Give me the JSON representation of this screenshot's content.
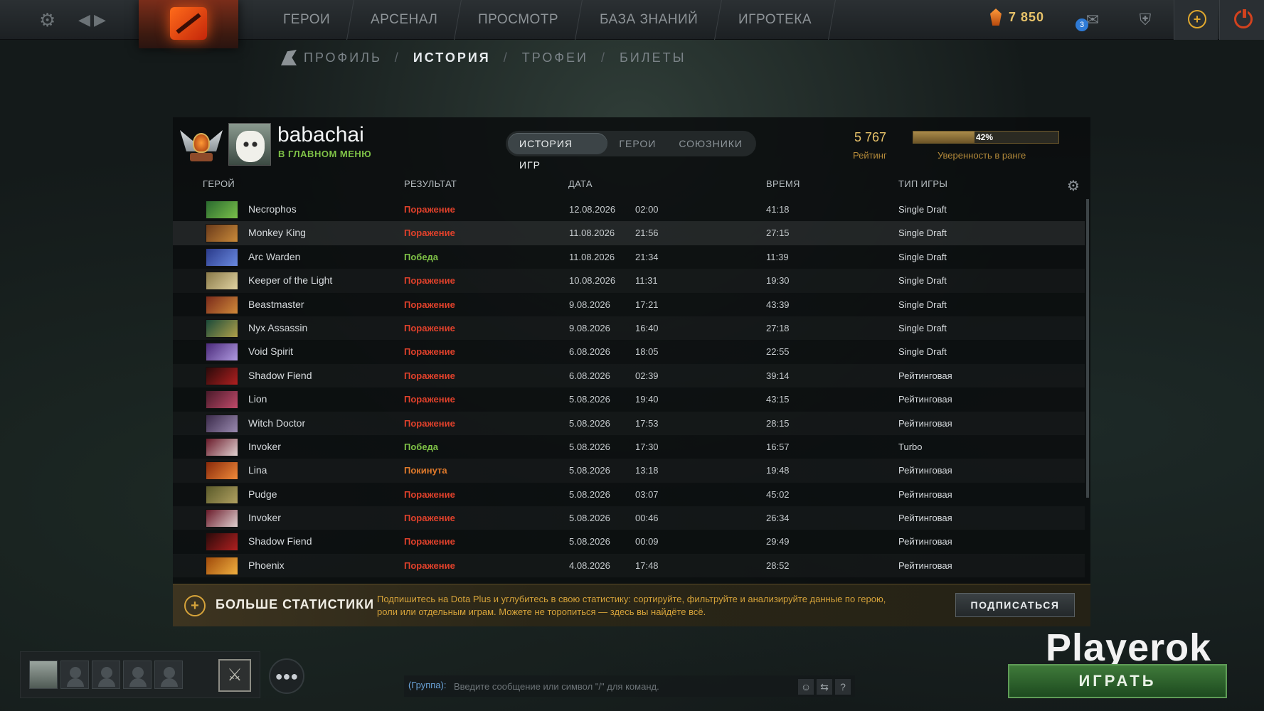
{
  "topbar": {
    "nav": [
      "ГЕРОИ",
      "АРСЕНАЛ",
      "ПРОСМОТР",
      "БАЗА ЗНАНИЙ",
      "ИГРОТЕКА"
    ],
    "currency": "7 850",
    "notifications": "3"
  },
  "subnav": {
    "items": [
      "ПРОФИЛЬ",
      "ИСТОРИЯ",
      "ТРОФЕИ",
      "БИЛЕТЫ"
    ],
    "active": "ИСТОРИЯ",
    "separator": "/"
  },
  "profile": {
    "username": "babachai",
    "status": "В ГЛАВНОМ МЕНЮ",
    "rating_value": "5 767",
    "rating_label": "Рейтинг",
    "confidence_value": 42,
    "confidence_text": "42%",
    "confidence_label": "Уверенность в ранге"
  },
  "tabs": [
    "ИСТОРИЯ ИГР",
    "ГЕРОИ",
    "СОЮЗНИКИ"
  ],
  "columns": {
    "hero": "ГЕРОЙ",
    "result": "РЕЗУЛЬТАТ",
    "date": "ДАТА",
    "time": "ВРЕМЯ",
    "mode": "ТИП ИГРЫ"
  },
  "matches": [
    {
      "hero": "Necrophos",
      "result": "Поражение",
      "outcome": "loss",
      "date": "12.08.2026",
      "time": "02:00",
      "duration": "41:18",
      "mode": "Single Draft",
      "colors": [
        "#2a6a2f",
        "#7ac04a"
      ]
    },
    {
      "hero": "Monkey King",
      "result": "Поражение",
      "outcome": "loss",
      "date": "11.08.2026",
      "time": "21:56",
      "duration": "27:15",
      "mode": "Single Draft",
      "colors": [
        "#6a3a1a",
        "#c98a3a"
      ]
    },
    {
      "hero": "Arc Warden",
      "result": "Победа",
      "outcome": "win",
      "date": "11.08.2026",
      "time": "21:34",
      "duration": "11:39",
      "mode": "Single Draft",
      "colors": [
        "#2a3a8a",
        "#6a8ae0"
      ]
    },
    {
      "hero": "Keeper of the Light",
      "result": "Поражение",
      "outcome": "loss",
      "date": "10.08.2026",
      "time": "11:31",
      "duration": "19:30",
      "mode": "Single Draft",
      "colors": [
        "#8a7a4a",
        "#e0d2a0"
      ]
    },
    {
      "hero": "Beastmaster",
      "result": "Поражение",
      "outcome": "loss",
      "date": "9.08.2026",
      "time": "17:21",
      "duration": "43:39",
      "mode": "Single Draft",
      "colors": [
        "#7a2a1a",
        "#d08a3a"
      ]
    },
    {
      "hero": "Nyx Assassin",
      "result": "Поражение",
      "outcome": "loss",
      "date": "9.08.2026",
      "time": "16:40",
      "duration": "27:18",
      "mode": "Single Draft",
      "colors": [
        "#1a4a3a",
        "#b0a04a"
      ]
    },
    {
      "hero": "Void Spirit",
      "result": "Поражение",
      "outcome": "loss",
      "date": "6.08.2026",
      "time": "18:05",
      "duration": "22:55",
      "mode": "Single Draft",
      "colors": [
        "#4a2a7a",
        "#b09ae0"
      ]
    },
    {
      "hero": "Shadow Fiend",
      "result": "Поражение",
      "outcome": "loss",
      "date": "6.08.2026",
      "time": "02:39",
      "duration": "39:14",
      "mode": "Рейтинговая",
      "colors": [
        "#2a0a0a",
        "#b02020"
      ]
    },
    {
      "hero": "Lion",
      "result": "Поражение",
      "outcome": "loss",
      "date": "5.08.2026",
      "time": "19:40",
      "duration": "43:15",
      "mode": "Рейтинговая",
      "colors": [
        "#4a1a2a",
        "#c04a6a"
      ]
    },
    {
      "hero": "Witch Doctor",
      "result": "Поражение",
      "outcome": "loss",
      "date": "5.08.2026",
      "time": "17:53",
      "duration": "28:15",
      "mode": "Рейтинговая",
      "colors": [
        "#3a2a4a",
        "#9a8ab0"
      ]
    },
    {
      "hero": "Invoker",
      "result": "Победа",
      "outcome": "win",
      "date": "5.08.2026",
      "time": "17:30",
      "duration": "16:57",
      "mode": "Turbo",
      "colors": [
        "#6a1a2a",
        "#e0d0d0"
      ]
    },
    {
      "hero": "Lina",
      "result": "Покинута",
      "outcome": "abandon",
      "date": "5.08.2026",
      "time": "13:18",
      "duration": "19:48",
      "mode": "Рейтинговая",
      "colors": [
        "#8a2a0a",
        "#f08a3a"
      ]
    },
    {
      "hero": "Pudge",
      "result": "Поражение",
      "outcome": "loss",
      "date": "5.08.2026",
      "time": "03:07",
      "duration": "45:02",
      "mode": "Рейтинговая",
      "colors": [
        "#5a5a2a",
        "#b0a060"
      ]
    },
    {
      "hero": "Invoker",
      "result": "Поражение",
      "outcome": "loss",
      "date": "5.08.2026",
      "time": "00:46",
      "duration": "26:34",
      "mode": "Рейтинговая",
      "colors": [
        "#6a1a2a",
        "#e0d0d0"
      ]
    },
    {
      "hero": "Shadow Fiend",
      "result": "Поражение",
      "outcome": "loss",
      "date": "5.08.2026",
      "time": "00:09",
      "duration": "29:49",
      "mode": "Рейтинговая",
      "colors": [
        "#2a0a0a",
        "#b02020"
      ]
    },
    {
      "hero": "Phoenix",
      "result": "Поражение",
      "outcome": "loss",
      "date": "4.08.2026",
      "time": "17:48",
      "duration": "28:52",
      "mode": "Рейтинговая",
      "colors": [
        "#a04a0a",
        "#f0b040"
      ]
    }
  ],
  "result_colors": {
    "loss": "#e0412b",
    "win": "#7fc247",
    "abandon": "#e07a2b"
  },
  "banner": {
    "title": "БОЛЬШЕ СТАТИСТИКИ",
    "text": "Подпишитесь на Dota Plus и углубитесь в свою статистику: сортируйте, фильтруйте и анализируйте данные по герою, роли или отдельным играм. Можете не торопиться — здесь вы найдёте всё.",
    "button": "ПОДПИСАТЬСЯ"
  },
  "chat": {
    "label": "(Группа):",
    "placeholder": "Введите сообщение или символ \"/\" для команд."
  },
  "watermark": "Playerok",
  "play_button": "ИГРАТЬ"
}
